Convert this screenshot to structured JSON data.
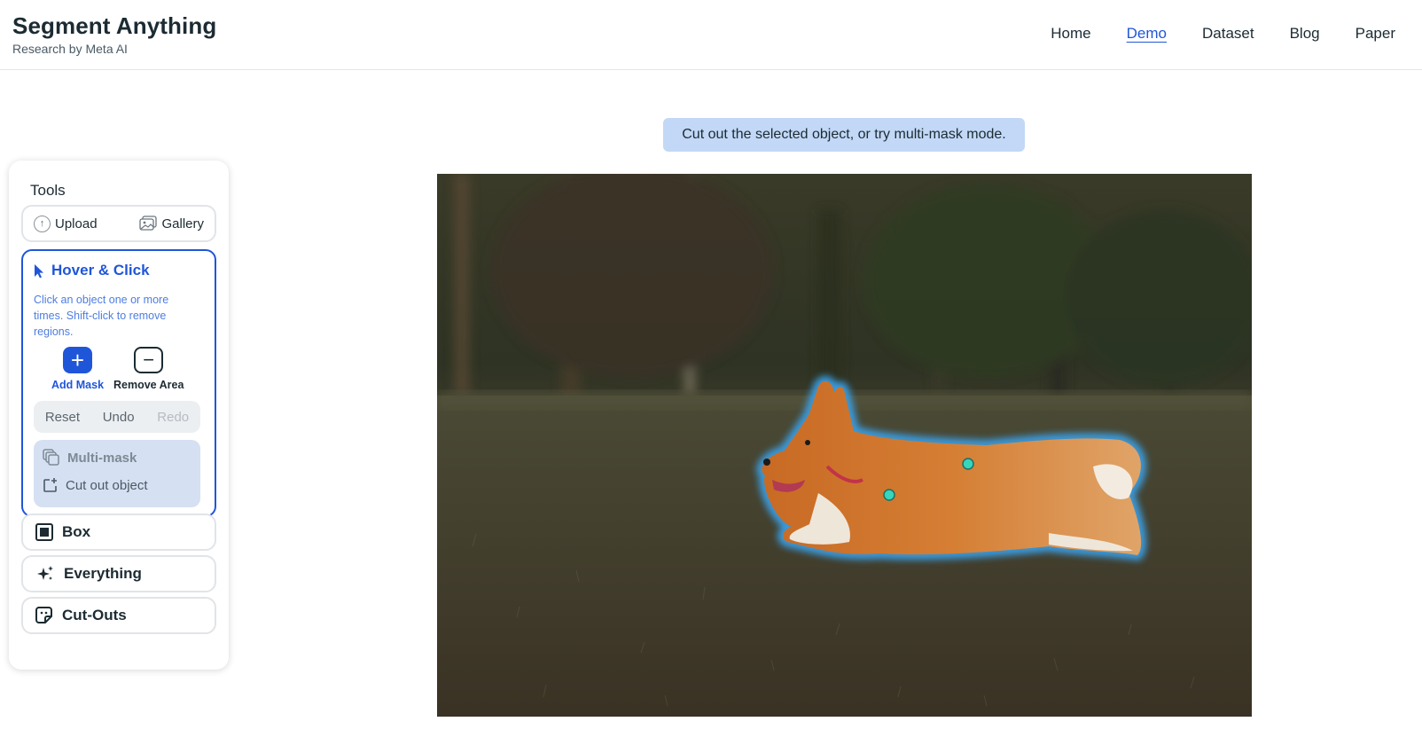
{
  "brand": {
    "title": "Segment Anything",
    "subtitle": "Research by Meta AI"
  },
  "nav": {
    "items": [
      "Home",
      "Demo",
      "Dataset",
      "Blog",
      "Paper"
    ],
    "active": "Demo"
  },
  "tools": {
    "title": "Tools",
    "upload_label": "Upload",
    "gallery_label": "Gallery",
    "hover_click": {
      "title": "Hover & Click",
      "description": "Click an object one or more times. Shift-click to remove regions.",
      "add_mask_label": "Add Mask",
      "remove_area_label": "Remove Area",
      "reset_label": "Reset",
      "undo_label": "Undo",
      "redo_label": "Redo",
      "multi_mask_label": "Multi-mask",
      "cut_out_label": "Cut out object"
    },
    "box_label": "Box",
    "everything_label": "Everything",
    "cutouts_label": "Cut-Outs"
  },
  "hint_text": "Cut out the selected object, or try multi-mask mode.",
  "colors": {
    "accent": "#1f56d9",
    "hint_bg": "#c2d8f6",
    "mask_glow": "#3aa0e8",
    "point": "#35d6b9"
  },
  "icons": [
    "upload-icon",
    "gallery-icon",
    "cursor-icon",
    "plus-icon",
    "minus-icon",
    "multi-mask-icon",
    "cut-out-icon",
    "box-icon",
    "sparkle-icon",
    "cutouts-icon"
  ]
}
